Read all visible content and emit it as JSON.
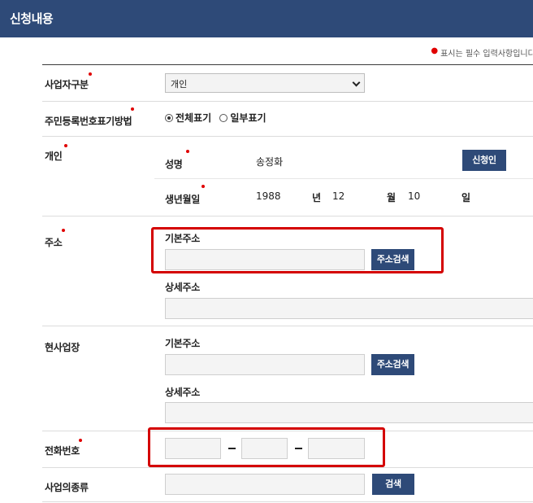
{
  "header": {
    "title": "신청내용"
  },
  "required_note": "표시는 필수 입력사항입니다.",
  "fields": {
    "business_type": {
      "label": "사업자구분",
      "selected": "개인"
    },
    "id_display": {
      "label": "주민등록번호표기방법",
      "options": [
        "전체표기",
        "일부표기"
      ],
      "selected_index": 0
    },
    "individual": {
      "label": "개인",
      "name_label": "성명",
      "name_value": "송정화",
      "applicant_button": "신청인",
      "birth_label": "생년월일",
      "year": "1988",
      "year_unit": "년",
      "month": "12",
      "month_unit": "월",
      "day": "10",
      "day_unit": "일"
    },
    "address": {
      "label": "주소",
      "basic_label": "기본주소",
      "search_button": "주소검색",
      "detail_label": "상세주소"
    },
    "workplace": {
      "label": "현사업장",
      "basic_label": "기본주소",
      "search_button": "주소검색",
      "detail_label": "상세주소"
    },
    "phone": {
      "label": "전화번호"
    },
    "business_kind": {
      "label": "사업의종류",
      "search_button": "검색"
    }
  },
  "colors": {
    "header_bg": "#2e4a78",
    "button_bg": "#2e4a78",
    "required_dot": "#e00000",
    "highlight_box": "#d40000"
  }
}
